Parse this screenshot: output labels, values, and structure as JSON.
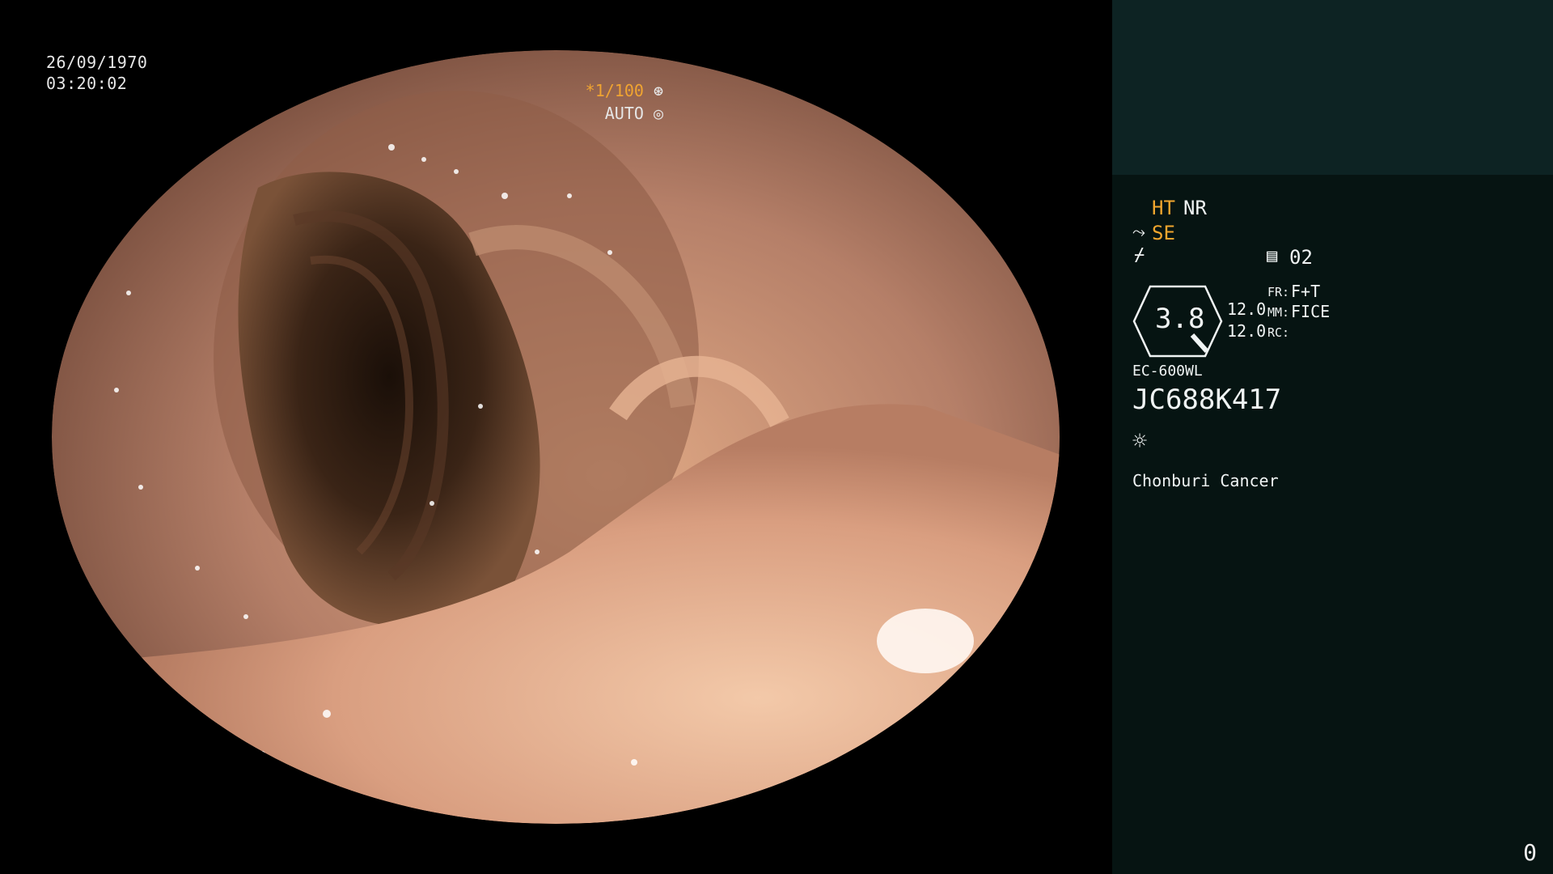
{
  "overlay": {
    "date": "26/09/1970",
    "time": "03:20:02",
    "shutter_speed": "*1/100",
    "iris_mode": "AUTO"
  },
  "panel": {
    "mode_ht": "HT",
    "mode_nr": "NR",
    "mode_se": "SE",
    "memory_value": "02",
    "gauge_value": "3.8",
    "gauge_top_value": "12.0",
    "gauge_bottom_value": "12.0",
    "fr_label": "FR:",
    "fr_value": "F+T",
    "mm_label": "MM:",
    "mm_value": "FICE",
    "rc_label": "RC:",
    "scope_model": "EC-600WL",
    "patient_id": "JC688K417",
    "institution": "Chonburi Cancer",
    "footer_count": "0"
  },
  "colors": {
    "accent_orange": "#f2a62e",
    "panel_bg": "#061412",
    "panel_header_bg": "#0d2323"
  },
  "icons": [
    "shutter-icon",
    "iris-icon",
    "scope-icon",
    "flash-icon",
    "memory-icon",
    "light-icon"
  ]
}
